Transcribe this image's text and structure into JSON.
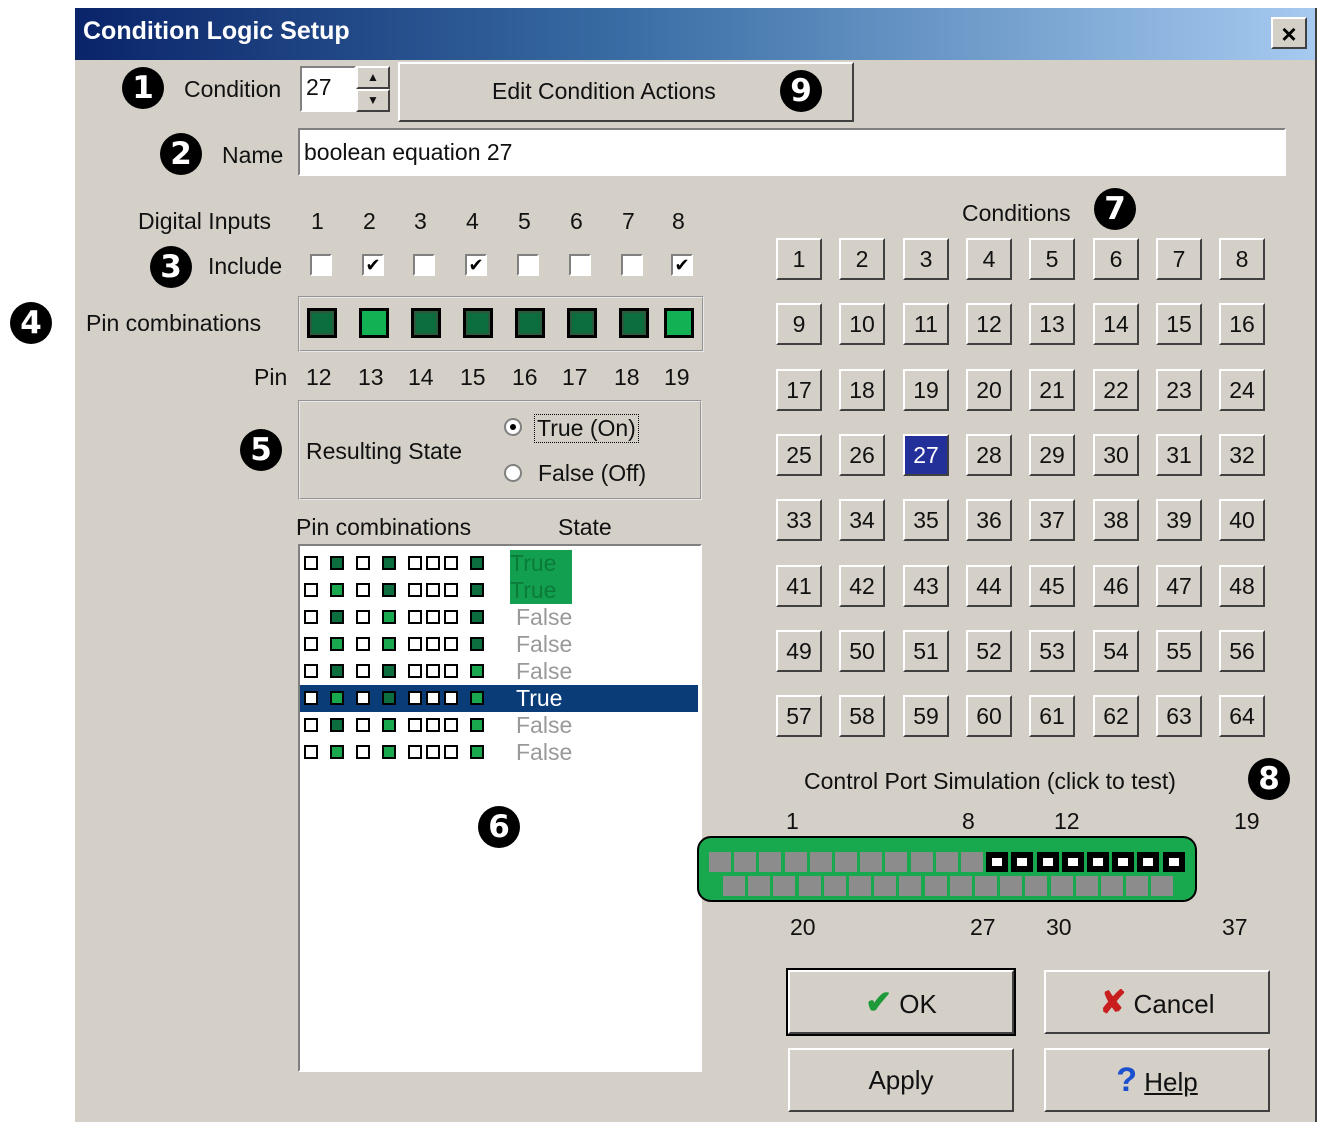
{
  "window": {
    "title": "Condition Logic Setup",
    "close_label": "×"
  },
  "callouts": [
    "1",
    "2",
    "3",
    "4",
    "5",
    "6",
    "7",
    "8",
    "9"
  ],
  "condition": {
    "label": "Condition",
    "value": "27",
    "edit_actions_label": "Edit Condition Actions"
  },
  "name": {
    "label": "Name",
    "value": "boolean equation 27"
  },
  "digital_inputs": {
    "label": "Digital Inputs",
    "numbers": [
      "1",
      "2",
      "3",
      "4",
      "5",
      "6",
      "7",
      "8"
    ],
    "include_label": "Include",
    "included": [
      false,
      true,
      false,
      true,
      false,
      false,
      false,
      true
    ]
  },
  "pin_combinations": {
    "label": "Pin combinations",
    "states": [
      "dark",
      "on",
      "dark",
      "dark",
      "dark",
      "dark",
      "dark",
      "on"
    ],
    "pin_label": "Pin",
    "pins": [
      "12",
      "13",
      "14",
      "15",
      "16",
      "17",
      "18",
      "19"
    ]
  },
  "resulting_state": {
    "label": "Resulting State",
    "options": [
      "True (On)",
      "False (Off)"
    ],
    "selected": "True (On)"
  },
  "truth_table": {
    "header_pins": "Pin combinations",
    "header_state": "State",
    "rows": [
      {
        "pins": [
          "off",
          "dark",
          "off",
          "dark",
          "off",
          "off",
          "off",
          "dark"
        ],
        "state": "True"
      },
      {
        "pins": [
          "off",
          "on",
          "off",
          "dark",
          "off",
          "off",
          "off",
          "dark"
        ],
        "state": "True"
      },
      {
        "pins": [
          "off",
          "dark",
          "off",
          "on",
          "off",
          "off",
          "off",
          "dark"
        ],
        "state": "False"
      },
      {
        "pins": [
          "off",
          "on",
          "off",
          "on",
          "off",
          "off",
          "off",
          "dark"
        ],
        "state": "False"
      },
      {
        "pins": [
          "off",
          "dark",
          "off",
          "dark",
          "off",
          "off",
          "off",
          "on"
        ],
        "state": "False"
      },
      {
        "pins": [
          "off",
          "on",
          "off",
          "dark",
          "off",
          "off",
          "off",
          "on"
        ],
        "state": "True"
      },
      {
        "pins": [
          "off",
          "dark",
          "off",
          "on",
          "off",
          "off",
          "off",
          "on"
        ],
        "state": "False"
      },
      {
        "pins": [
          "off",
          "on",
          "off",
          "on",
          "off",
          "off",
          "off",
          "on"
        ],
        "state": "False"
      }
    ],
    "selected_row": 5
  },
  "conditions": {
    "label": "Conditions",
    "buttons": [
      "1",
      "2",
      "3",
      "4",
      "5",
      "6",
      "7",
      "8",
      "9",
      "10",
      "11",
      "12",
      "13",
      "14",
      "15",
      "16",
      "17",
      "18",
      "19",
      "20",
      "21",
      "22",
      "23",
      "24",
      "25",
      "26",
      "27",
      "28",
      "29",
      "30",
      "31",
      "32",
      "33",
      "34",
      "35",
      "36",
      "37",
      "38",
      "39",
      "40",
      "41",
      "42",
      "43",
      "44",
      "45",
      "46",
      "47",
      "48",
      "49",
      "50",
      "51",
      "52",
      "53",
      "54",
      "55",
      "56",
      "57",
      "58",
      "59",
      "60",
      "61",
      "62",
      "63",
      "64"
    ],
    "selected": "27"
  },
  "control_port": {
    "label": "Control Port Simulation  (click to test)",
    "top_numbers": {
      "a": "1",
      "b": "8",
      "c": "12",
      "d": "19"
    },
    "bottom_numbers": {
      "a": "20",
      "b": "27",
      "c": "30",
      "d": "37"
    }
  },
  "buttons": {
    "ok": "OK",
    "cancel": "Cancel",
    "apply": "Apply",
    "help": "Help"
  },
  "colors": {
    "pin_on": "#12b254",
    "pin_dark": "#0c6d3e",
    "selection": "#24309a",
    "port_green": "#18a84d"
  }
}
